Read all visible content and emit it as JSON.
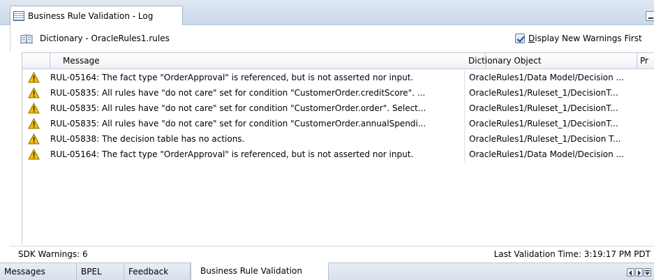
{
  "tab": {
    "title": "Business Rule Validation - Log",
    "icon": "log-list-icon"
  },
  "dictionary": {
    "icon": "book-icon",
    "label": "Dictionary - OracleRules1.rules",
    "checkbox_label": "Display New Warnings First",
    "checkbox_checked": true
  },
  "table": {
    "headers": [
      "Message",
      "Dictionary Object",
      "Pr"
    ],
    "rows": [
      {
        "icon": "warning-icon",
        "message": "RUL-05164: The fact type \"OrderApproval\" is referenced, but is not asserted nor input.",
        "object": "OracleRules1/Data Model/Decision ..."
      },
      {
        "icon": "warning-icon",
        "message": "RUL-05835: All rules have \"do not care\" set for condition \"CustomerOrder.creditScore\".  ...",
        "object": "OracleRules1/Ruleset_1/DecisionT..."
      },
      {
        "icon": "warning-icon",
        "message": "RUL-05835: All rules have \"do not care\" set for condition \"CustomerOrder.order\".  Select...",
        "object": "OracleRules1/Ruleset_1/DecisionT..."
      },
      {
        "icon": "warning-icon",
        "message": "RUL-05835: All rules have \"do not care\" set for condition \"CustomerOrder.annualSpendi...",
        "object": "OracleRules1/Ruleset_1/DecisionT..."
      },
      {
        "icon": "warning-icon",
        "message": "RUL-05838: The decision table has no actions.",
        "object": "OracleRules1/Ruleset_1/Decision T..."
      },
      {
        "icon": "warning-icon",
        "message": "RUL-05164: The fact type \"OrderApproval\" is referenced, but is not asserted nor input.",
        "object": "OracleRules1/Data Model/Decision ..."
      }
    ]
  },
  "status": {
    "warnings": "SDK Warnings: 6",
    "last_validation": "Last Validation Time: 3:19:17 PM PDT"
  },
  "bottom_tabs": [
    "Messages",
    "BPEL",
    "Feedback",
    "Business Rule Validation"
  ],
  "colors": {
    "warning": "#f2c200",
    "tab_bg": "#cad9ea",
    "border": "#c4ccd6"
  }
}
